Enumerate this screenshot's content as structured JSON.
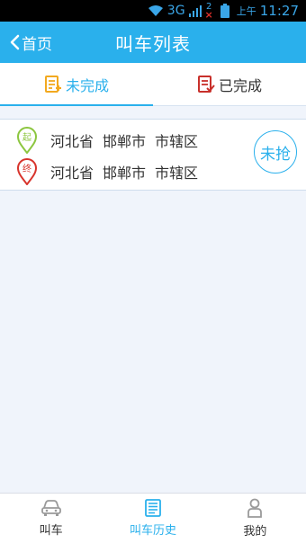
{
  "status_bar": {
    "network": "3G",
    "badge": "2",
    "am_pm": "上午",
    "time": "11:27"
  },
  "header": {
    "back_label": "首页",
    "title": "叫车列表"
  },
  "tabs": [
    {
      "label": "未完成",
      "active": true
    },
    {
      "label": "已完成",
      "active": false
    }
  ],
  "orders": [
    {
      "start_marker": "起",
      "end_marker": "终",
      "start": {
        "province": "河北省",
        "city": "邯郸市",
        "district": "市辖区"
      },
      "end": {
        "province": "河北省",
        "city": "邯郸市",
        "district": "市辖区"
      },
      "status": "未抢"
    }
  ],
  "bottom_nav": [
    {
      "label": "叫车",
      "icon": "car-icon",
      "active": false
    },
    {
      "label": "叫车历史",
      "icon": "history-list-icon",
      "active": true
    },
    {
      "label": "我的",
      "icon": "person-icon",
      "active": false
    }
  ],
  "colors": {
    "accent": "#2ab0ec",
    "start_pin": "#8cc63f",
    "end_pin": "#d8342c",
    "pending_tab_icon": "#f2a91f",
    "done_tab_icon": "#c8302b"
  }
}
